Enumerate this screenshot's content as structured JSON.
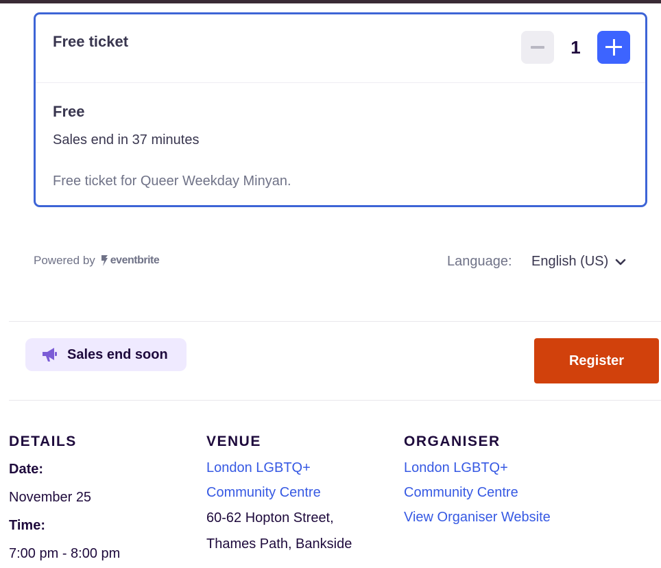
{
  "ticket": {
    "name": "Free ticket",
    "quantity": "1",
    "price": "Free",
    "sales_end": "Sales end in 37 minutes",
    "description": "Free ticket for Queer Weekday Minyan."
  },
  "footer": {
    "powered_by": "Powered by",
    "brand": "eventbrite",
    "language_label": "Language:",
    "language_value": "English (US)"
  },
  "checkout": {
    "badge_text": "Sales end soon",
    "register_label": "Register"
  },
  "details": {
    "heading": "DETAILS",
    "date_label": "Date:",
    "date_value": "November 25",
    "time_label": "Time:",
    "time_value": "7:00 pm - 8:00 pm"
  },
  "venue": {
    "heading": "VENUE",
    "name_line1": "London LGBTQ+",
    "name_line2": "Community Centre",
    "address_line1": "60-62 Hopton Street,",
    "address_line2": "Thames Path, Bankside"
  },
  "organiser": {
    "heading": "ORGANISER",
    "name_line1": "London LGBTQ+",
    "name_line2": "Community Centre",
    "website_link": "View Organiser Website"
  },
  "colors": {
    "accent_blue": "#3d64ff",
    "card_border": "#3d64d6",
    "register_orange": "#d1410c",
    "badge_bg": "#efeaff",
    "link_blue": "#3659e3"
  },
  "icons": {
    "minus": "minus-icon",
    "plus": "plus-icon",
    "megaphone": "megaphone-icon",
    "chevron": "chevron-down-icon",
    "brand_logo": "eventbrite-logo-icon"
  }
}
